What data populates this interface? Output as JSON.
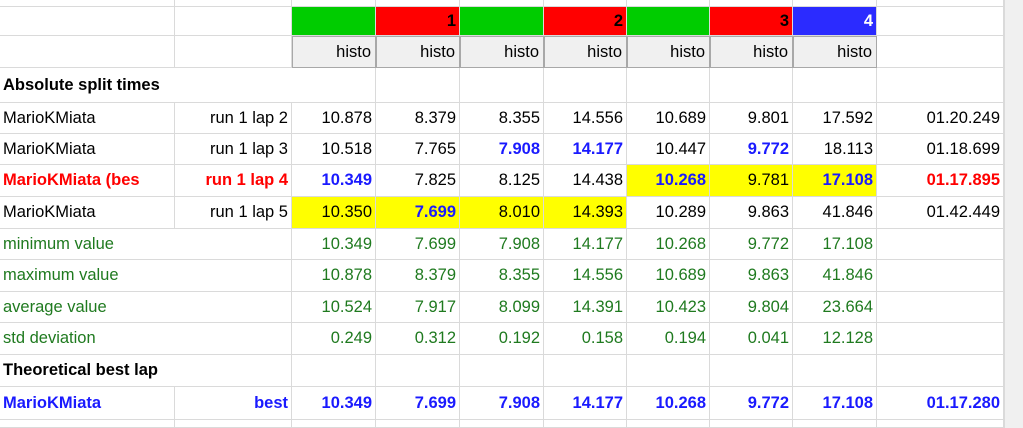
{
  "colors": {
    "green": "#00cc00",
    "red": "#ff0000",
    "blue": "#2b2bff",
    "highlight": "#ffff00",
    "blue_text": "#1a1aff",
    "green_text": "#1f7a1f",
    "red_text": "#ff0000"
  },
  "segments": [
    {
      "fill": "green",
      "label": ""
    },
    {
      "fill": "red",
      "label": "1"
    },
    {
      "fill": "green",
      "label": ""
    },
    {
      "fill": "red",
      "label": "2"
    },
    {
      "fill": "green",
      "label": ""
    },
    {
      "fill": "red",
      "label": "3"
    },
    {
      "fill": "blue",
      "label": "4"
    }
  ],
  "histo_label": "histo",
  "section_absolute": "Absolute split times",
  "section_theoretical": "Theoretical best lap",
  "runs": [
    {
      "name": "MarioKMiata",
      "run": "run 1 lap 2",
      "style": "normal",
      "values": [
        "10.878",
        "8.379",
        "8.355",
        "14.556",
        "10.689",
        "9.801",
        "17.592"
      ],
      "total": "01.20.249",
      "fmt": [
        "",
        "",
        "",
        "",
        "",
        "",
        ""
      ],
      "totalfmt": ""
    },
    {
      "name": "MarioKMiata",
      "run": "run 1 lap 3",
      "style": "normal",
      "values": [
        "10.518",
        "7.765",
        "7.908",
        "14.177",
        "10.447",
        "9.772",
        "18.113"
      ],
      "total": "01.18.699",
      "fmt": [
        "",
        "",
        "b",
        "b",
        "",
        "b",
        ""
      ],
      "totalfmt": ""
    },
    {
      "name": "MarioKMiata (bes",
      "run": "run 1 lap 4",
      "style": "red",
      "values": [
        "10.349",
        "7.825",
        "8.125",
        "14.438",
        "10.268",
        "9.781",
        "17.108"
      ],
      "total": "01.17.895",
      "fmt": [
        "b",
        "",
        "",
        "",
        "bh",
        "h",
        "bh"
      ],
      "totalfmt": "r"
    },
    {
      "name": "MarioKMiata",
      "run": "run 1 lap 5",
      "style": "normal",
      "values": [
        "10.350",
        "7.699",
        "8.010",
        "14.393",
        "10.289",
        "9.863",
        "41.846"
      ],
      "total": "01.42.449",
      "fmt": [
        "h",
        "bh",
        "h",
        "h",
        "",
        "",
        ""
      ],
      "totalfmt": ""
    }
  ],
  "stats": [
    {
      "label": "minimum value",
      "values": [
        "10.349",
        "7.699",
        "7.908",
        "14.177",
        "10.268",
        "9.772",
        "17.108"
      ]
    },
    {
      "label": "maximum value",
      "values": [
        "10.878",
        "8.379",
        "8.355",
        "14.556",
        "10.689",
        "9.863",
        "41.846"
      ]
    },
    {
      "label": "average value",
      "values": [
        "10.524",
        "7.917",
        "8.099",
        "14.391",
        "10.423",
        "9.804",
        "23.664"
      ]
    },
    {
      "label": "std deviation",
      "values": [
        "0.249",
        "0.312",
        "0.192",
        "0.158",
        "0.194",
        "0.041",
        "12.128"
      ]
    }
  ],
  "best": {
    "name": "MarioKMiata",
    "run": "best",
    "values": [
      "10.349",
      "7.699",
      "7.908",
      "14.177",
      "10.268",
      "9.772",
      "17.108"
    ],
    "total": "01.17.280"
  }
}
